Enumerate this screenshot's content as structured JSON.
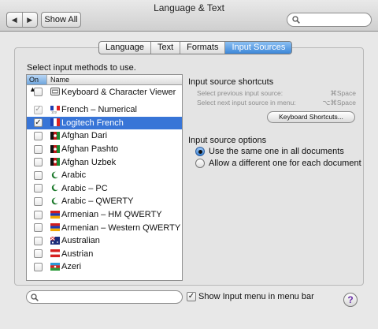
{
  "window": {
    "title": "Language & Text",
    "back_glyph": "◀",
    "forward_glyph": "▶",
    "show_all_label": "Show All",
    "search_placeholder": ""
  },
  "tabs": [
    {
      "label": "Language",
      "active": false
    },
    {
      "label": "Text",
      "active": false
    },
    {
      "label": "Formats",
      "active": false
    },
    {
      "label": "Input Sources",
      "active": true
    }
  ],
  "input_methods": {
    "prompt": "Select input methods to use.",
    "header_on": "On ▲",
    "header_name": "Name",
    "check_glyph": "✓",
    "items": [
      {
        "name": "Keyboard & Character Viewer",
        "checked": false,
        "icon": "keyboard-viewer-icon",
        "flag": "kbd"
      },
      {
        "name": "French – Numerical",
        "checked": true,
        "dim": true,
        "icon": "french-flag-icon",
        "flag": "fr-num"
      },
      {
        "name": "Logitech French",
        "checked": true,
        "selected": true,
        "icon": "french-flag-icon",
        "flag": "fr"
      },
      {
        "name": "Afghan Dari",
        "checked": false,
        "icon": "afghanistan-flag-icon",
        "flag": "af"
      },
      {
        "name": "Afghan Pashto",
        "checked": false,
        "icon": "afghanistan-flag-icon",
        "flag": "af"
      },
      {
        "name": "Afghan Uzbek",
        "checked": false,
        "icon": "afghanistan-flag-icon",
        "flag": "af"
      },
      {
        "name": "Arabic",
        "checked": false,
        "icon": "arabic-crescent-icon",
        "flag": "ar"
      },
      {
        "name": "Arabic – PC",
        "checked": false,
        "icon": "arabic-crescent-icon",
        "flag": "ar"
      },
      {
        "name": "Arabic – QWERTY",
        "checked": false,
        "icon": "arabic-crescent-icon",
        "flag": "ar"
      },
      {
        "name": "Armenian – HM QWERTY",
        "checked": false,
        "icon": "armenia-flag-icon",
        "flag": "am"
      },
      {
        "name": "Armenian – Western QWERTY",
        "checked": false,
        "icon": "armenia-flag-icon",
        "flag": "am"
      },
      {
        "name": "Australian",
        "checked": false,
        "icon": "australia-flag-icon",
        "flag": "au"
      },
      {
        "name": "Austrian",
        "checked": false,
        "icon": "austria-flag-icon",
        "flag": "at"
      },
      {
        "name": "Azeri",
        "checked": false,
        "icon": "azerbaijan-flag-icon",
        "flag": "az"
      }
    ]
  },
  "shortcuts": {
    "title": "Input source shortcuts",
    "prev_label": "Select previous input source:",
    "prev_key": "⌘Space",
    "next_label": "Select next input source in menu:",
    "next_key": "⌥⌘Space",
    "button_label": "Keyboard Shortcuts..."
  },
  "options": {
    "title": "Input source options",
    "same_label": "Use the same one in all documents",
    "different_label": "Allow a different one for each document",
    "selected": "same"
  },
  "bottom": {
    "search_placeholder": "",
    "show_menu_label": "Show Input menu in menu bar",
    "show_menu_checked": true,
    "help_glyph": "?"
  },
  "colors": {
    "selection": "#3875d7",
    "tab_active": "#3c86d8"
  }
}
